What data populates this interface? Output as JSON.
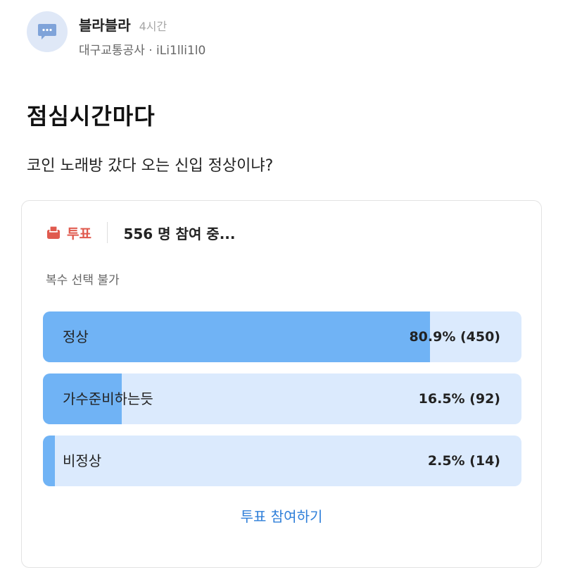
{
  "post": {
    "author": "블라블라",
    "time": "4시간",
    "company_line": "대구교통공사 · iLi1lli1l0",
    "title": "점심시간마다",
    "body": "코인 노래방 갔다 오는 신입 정상이냐?"
  },
  "poll": {
    "label": "투표",
    "participants": "556 명 참여 중...",
    "multi_note": "복수 선택 불가",
    "options": [
      {
        "label": "정상",
        "value_text": "80.9% (450)",
        "percent": 80.9
      },
      {
        "label": "가수준비하는듯",
        "value_text": "16.5% (92)",
        "percent": 16.5
      },
      {
        "label": "비정상",
        "value_text": "2.5% (14)",
        "percent": 2.5
      }
    ],
    "vote_button": "투표 참여하기"
  },
  "colors": {
    "bar_fill": "#70b3f5",
    "bar_track": "#dbeafd",
    "poll_accent": "#e05a4e",
    "link": "#2f7fd9"
  },
  "icons": {
    "avatar": "chat-bubble-icon",
    "poll": "ballot-box-icon"
  }
}
